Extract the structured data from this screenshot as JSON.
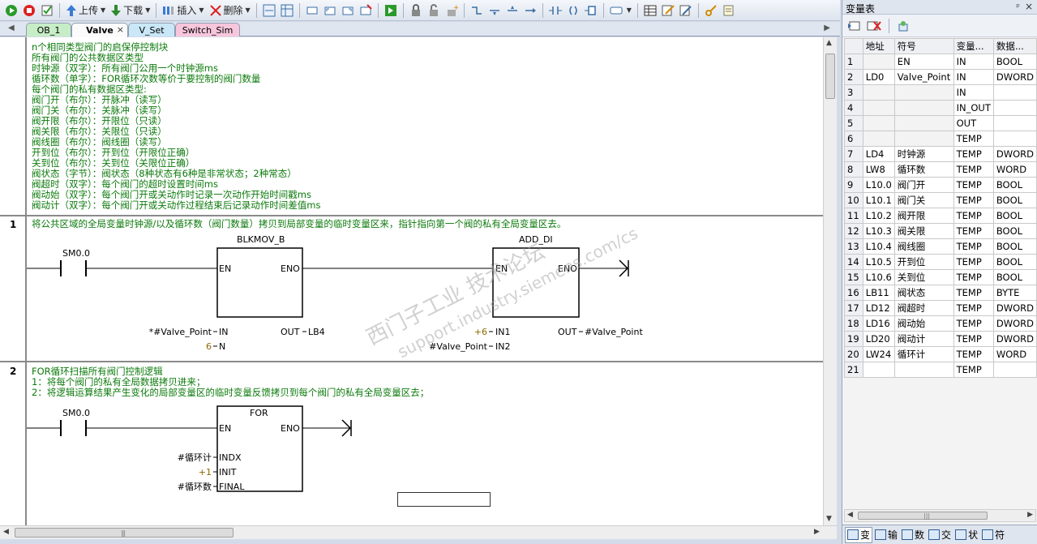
{
  "toolbar": {
    "upload_label": "上传",
    "download_label": "下载",
    "insert_label": "插入",
    "delete_label": "删除"
  },
  "tabs": [
    {
      "label": "OB_1",
      "color": "#c7edc7"
    },
    {
      "label": "Valve",
      "color": "#fbfbfb"
    },
    {
      "label": "V_Set",
      "color": "#c9e7f7"
    },
    {
      "label": "Switch_Sim",
      "color": "#f7c6dc"
    }
  ],
  "block_comment": [
    "n个相同类型阀门的启保停控制块",
    "所有阀门的公共数据区类型",
    "时钟源（双字）：所有阀门公用一个时钟源ms",
    "循环数（单字）：FOR循环次数等价于要控制的阀门数量",
    "每个阀门的私有数据区类型:",
    "阀门开（布尔）：开脉冲（读写）",
    "阀门关（布尔）：关脉冲（读写）",
    "阀开限（布尔）：开限位（只读）",
    "阀关限（布尔）：关限位（只读）",
    "阀线圈（布尔）：阀线圈（读写）",
    "开到位（布尔）：开到位（开限位正确）",
    "关到位（布尔）：关到位（关限位正确）",
    "阀状态（字节）：阀状态（8种状态有6种是非常状态；2种常态）",
    "阀超时（双字）：每个阀门的超时设置时间ms",
    "阀动始（双字）：每个阀门开或关动作时记录一次动作开始时间戳ms",
    "阀动计（双字）：每个阀门开或关动作过程结束后记录动作时间差值ms"
  ],
  "network1": {
    "number": "1",
    "comment": "将公共区域的全局变量时钟源/以及循环数（阀门数量）拷贝到局部变量的临时变量区来，指针指向第一个阀的私有全局变量区去。",
    "contact": "SM0.0",
    "blk1": {
      "name": "BLKMOV_B",
      "en": "EN",
      "eno": "ENO",
      "in": "IN",
      "out": "OUT",
      "n": "N",
      "in_val": "*#Valve_Point",
      "n_val": "6",
      "out_val": "LB4"
    },
    "blk2": {
      "name": "ADD_DI",
      "en": "EN",
      "eno": "ENO",
      "in1": "IN1",
      "in2": "IN2",
      "out": "OUT",
      "in1_val": "+6",
      "in2_val": "#Valve_Point",
      "out_val": "#Valve_Point"
    }
  },
  "network2": {
    "number": "2",
    "comment": [
      "FOR循环扫描所有阀门控制逻辑",
      "1：将每个阀门的私有全局数据拷贝进来；",
      "2：将逻辑运算结果产生变化的局部变量区的临时变量反馈拷贝到每个阀门的私有全局变量区去；"
    ],
    "contact": "SM0.0",
    "blk": {
      "name": "FOR",
      "en": "EN",
      "eno": "ENO",
      "indx": "INDX",
      "init": "INIT",
      "final": "FINAL",
      "indx_val": "#循环计",
      "init_val": "+1",
      "final_val": "#循环数"
    }
  },
  "watermark": [
    "西门子工业 技术论坛",
    "support.industry.siemens.com/cs"
  ],
  "var_panel": {
    "title": "变量表",
    "pin": "ᵖ",
    "close": "×",
    "headers": [
      "",
      "地址",
      "符号",
      "变量...",
      "数据..."
    ],
    "rows": [
      [
        "1",
        "",
        "EN",
        "IN",
        "BOOL"
      ],
      [
        "2",
        "LD0",
        "Valve_Point",
        "IN",
        "DWORD"
      ],
      [
        "3",
        "",
        "",
        "IN",
        ""
      ],
      [
        "4",
        "",
        "",
        "IN_OUT",
        ""
      ],
      [
        "5",
        "",
        "",
        "OUT",
        ""
      ],
      [
        "6",
        "",
        "",
        "TEMP",
        ""
      ],
      [
        "7",
        "LD4",
        "时钟源",
        "TEMP",
        "DWORD"
      ],
      [
        "8",
        "LW8",
        "循环数",
        "TEMP",
        "WORD"
      ],
      [
        "9",
        "L10.0",
        "阀门开",
        "TEMP",
        "BOOL"
      ],
      [
        "10",
        "L10.1",
        "阀门关",
        "TEMP",
        "BOOL"
      ],
      [
        "11",
        "L10.2",
        "阀开限",
        "TEMP",
        "BOOL"
      ],
      [
        "12",
        "L10.3",
        "阀关限",
        "TEMP",
        "BOOL"
      ],
      [
        "13",
        "L10.4",
        "阀线圈",
        "TEMP",
        "BOOL"
      ],
      [
        "14",
        "L10.5",
        "开到位",
        "TEMP",
        "BOOL"
      ],
      [
        "15",
        "L10.6",
        "关到位",
        "TEMP",
        "BOOL"
      ],
      [
        "16",
        "LB11",
        "阀状态",
        "TEMP",
        "BYTE"
      ],
      [
        "17",
        "LD12",
        "阀超时",
        "TEMP",
        "DWORD"
      ],
      [
        "18",
        "LD16",
        "阀动始",
        "TEMP",
        "DWORD"
      ],
      [
        "19",
        "LD20",
        "阀动计",
        "TEMP",
        "DWORD"
      ],
      [
        "20",
        "LW24",
        "循环计",
        "TEMP",
        "WORD"
      ],
      [
        "21",
        "",
        "",
        "TEMP",
        ""
      ]
    ],
    "bottom_tabs": [
      "变",
      "输",
      "数",
      "交",
      "状",
      "符"
    ]
  }
}
